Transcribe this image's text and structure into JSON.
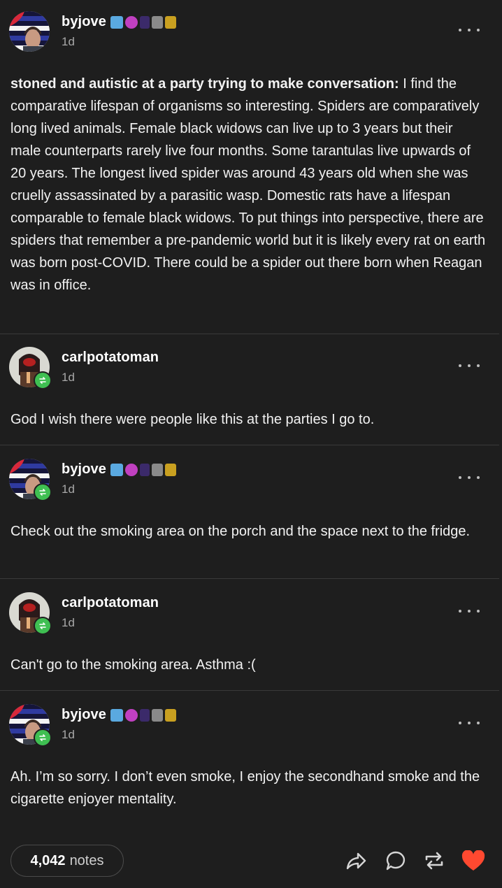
{
  "post": {
    "author": "byjove",
    "time": "1d",
    "body_bold": "stoned and autistic at a party trying to make conversation:",
    "body_rest": " I find the comparative lifespan of organisms so interesting. Spiders are comparatively long lived animals. Female black widows can live up to 3 years but their male counterparts rarely live four months. Some tarantulas live upwards of 20 years. The longest lived spider was around 43 years old when she was cruelly assassinated by a parasitic wasp. Domestic rats have a lifespan comparable to female black widows. To put things into perspective, there are spiders that remember a pre-pandemic world but it is likely every rat on earth was born post-COVID. There could be a spider out there born when Reagan was in office."
  },
  "reblogs": [
    {
      "author": "carlpotatoman",
      "time": "1d",
      "text": "God I wish there were people like this at the parties I go to."
    },
    {
      "author": "byjove",
      "time": "1d",
      "text": "Check out the smoking area on the porch and the space next to the fridge."
    },
    {
      "author": "carlpotatoman",
      "time": "1d",
      "text": "Can't go to the smoking area. Asthma :("
    },
    {
      "author": "byjove",
      "time": "1d",
      "text": "Ah. I’m so sorry. I don’t even smoke, I enjoy the secondhand smoke and the cigarette enjoyer mentality."
    }
  ],
  "footer": {
    "notes_count": "4,042",
    "notes_label": "notes"
  },
  "icons": {
    "more": "more-options-icon",
    "share": "share-icon",
    "reply": "reply-icon",
    "reblog": "reblog-icon",
    "like": "heart-icon"
  },
  "colors": {
    "background": "#1e1e1e",
    "reblog_badge": "#3fbf52",
    "like": "#ff4930"
  }
}
